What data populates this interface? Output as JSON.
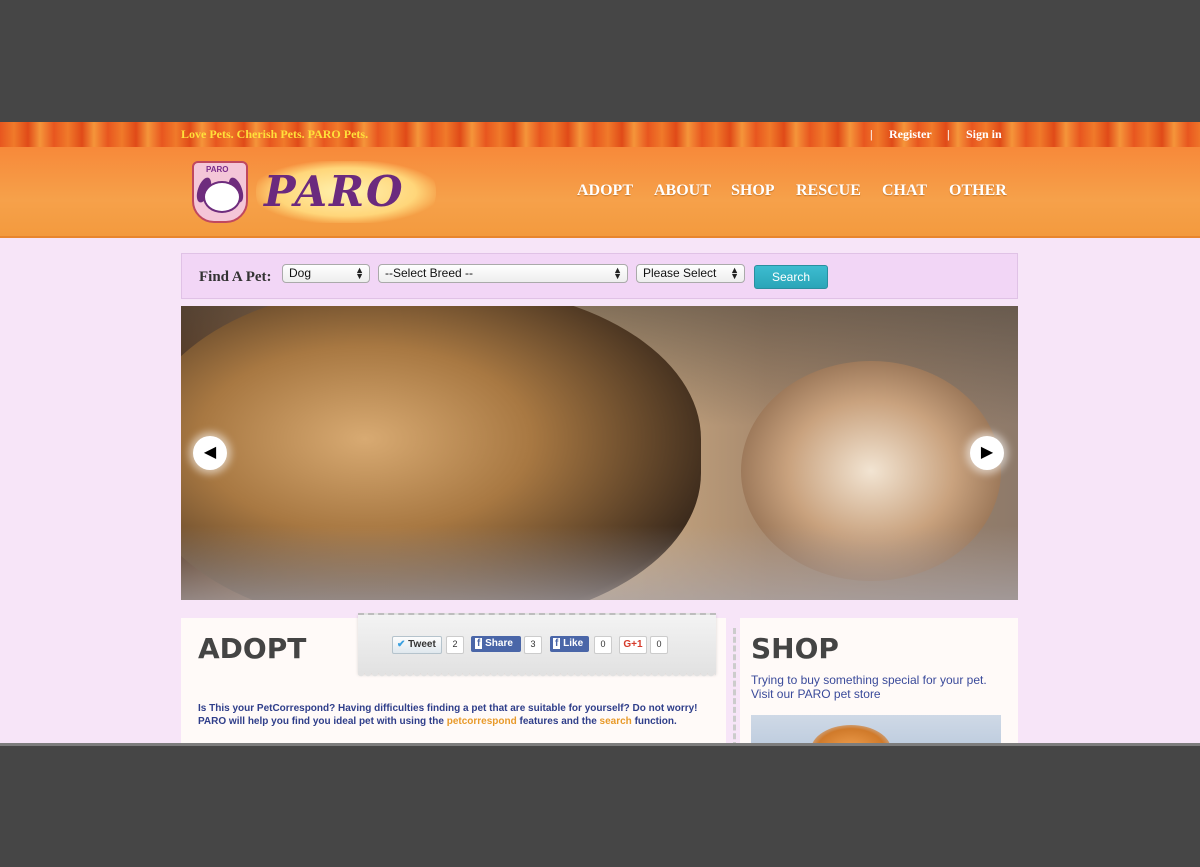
{
  "topbar": {
    "tagline": "Love Pets. Cherish Pets. PARO Pets.",
    "sep1": "|",
    "register": "Register",
    "sep2": "|",
    "signin": "Sign in"
  },
  "logo": {
    "shield_text": "PARO",
    "wordmark": "PARO"
  },
  "nav": [
    "ADOPT",
    "ABOUT",
    "SHOP",
    "RESCUE",
    "CHAT",
    "OTHER"
  ],
  "find": {
    "label": "Find A Pet:",
    "animal": "Dog",
    "breed": "--Select Breed --",
    "other": "Please Select",
    "button": "Search"
  },
  "hero": {
    "prev_icon": "arrow-left-icon",
    "next_icon": "arrow-right-icon"
  },
  "share": {
    "tweet": "Tweet",
    "tweet_count": "2",
    "share": "Share",
    "share_count": "3",
    "like": "Like",
    "like_count": "0",
    "gplus": "G+1",
    "gplus_count": "0"
  },
  "adopt": {
    "title": "ADOPT",
    "text_a": "Is This your PetCorrespond? Having difficulties finding a pet that are suitable for yourself? Do not worry! PARO will help you find you ideal pet with using the ",
    "link1": "petcorrespond",
    "text_b": " features and the ",
    "link2": "search",
    "text_c": " function."
  },
  "shop": {
    "title": "SHOP",
    "text": "Trying to buy something special for your pet. Visit our PARO pet store"
  },
  "colors": {
    "page_bg": "#f7e5f8",
    "header_orange": "#f7893a",
    "accent_teal": "#2aa5b8",
    "link_orange": "#e89a2a",
    "text_blue": "#2f3e8a"
  }
}
